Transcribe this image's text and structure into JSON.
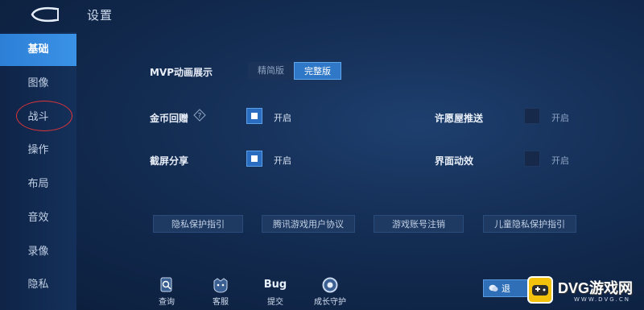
{
  "header": {
    "title": "设置"
  },
  "sidebar": {
    "items": [
      {
        "label": "基础",
        "active": true
      },
      {
        "label": "图像"
      },
      {
        "label": "战斗"
      },
      {
        "label": "操作"
      },
      {
        "label": "布局"
      },
      {
        "label": "音效"
      },
      {
        "label": "录像"
      },
      {
        "label": "隐私"
      }
    ]
  },
  "settings": {
    "mvp": {
      "label": "MVP动画展示",
      "options": [
        "精简版",
        "完整版"
      ],
      "selected": "完整版"
    },
    "coin_replay": {
      "label": "金币回赠",
      "toggle_text": "开启",
      "checked": true,
      "icon": "help-icon"
    },
    "screenshot_share": {
      "label": "截屏分享",
      "toggle_text": "开启",
      "checked": true
    },
    "wish_push": {
      "label": "许愿屋推送",
      "toggle_text": "开启",
      "checked": false
    },
    "ui_effects": {
      "label": "界面动效",
      "toggle_text": "开启",
      "checked": false
    }
  },
  "links": [
    "隐私保护指引",
    "腾讯游戏用户协议",
    "游戏账号注销",
    "儿童隐私保护指引"
  ],
  "bottom": [
    {
      "label": "查询",
      "icon": "search-doc-icon"
    },
    {
      "label": "客服",
      "icon": "customer-service-icon"
    },
    {
      "label": "提交",
      "icon": "bug-icon",
      "icon_text": "Bug"
    },
    {
      "label": "成长守护",
      "icon": "growth-guard-icon"
    }
  ],
  "logout": {
    "label": "退",
    "icon": "chat-icon"
  },
  "watermark": {
    "text": "DVG游戏网",
    "sub": "WWW.DVG.CN"
  },
  "colors": {
    "accent": "#2f78c8",
    "background": "#132c52",
    "annotation": "#e0343a",
    "watermark": "#f4c20d"
  }
}
